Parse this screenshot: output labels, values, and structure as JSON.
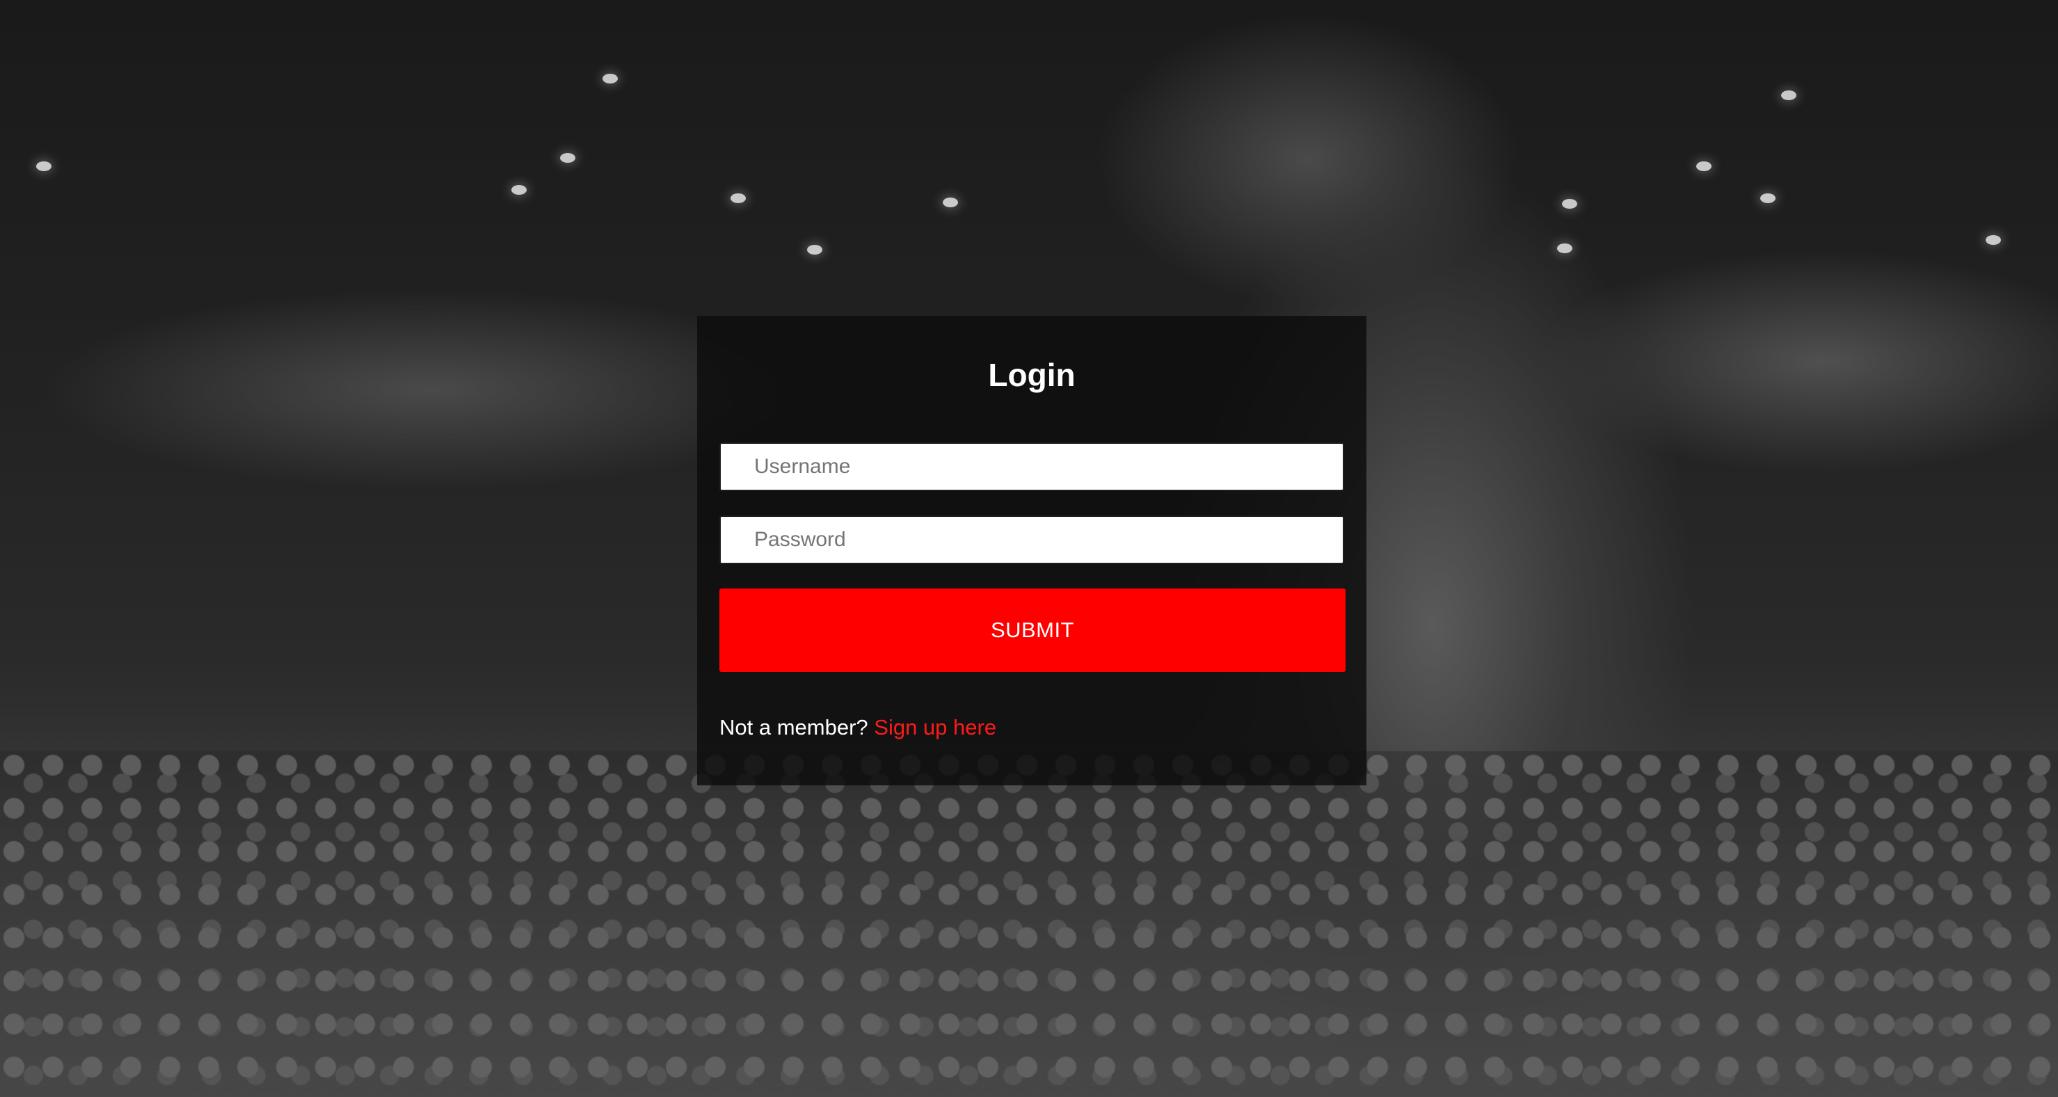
{
  "login": {
    "title": "Login",
    "username_placeholder": "Username",
    "password_placeholder": "Password",
    "submit_label": "SUBMIT",
    "signup_prompt": "Not a member?",
    "signup_link": "Sign up here"
  },
  "colors": {
    "accent": "#ff0000",
    "card_background": "#0c0c0c",
    "text": "#ffffff"
  }
}
